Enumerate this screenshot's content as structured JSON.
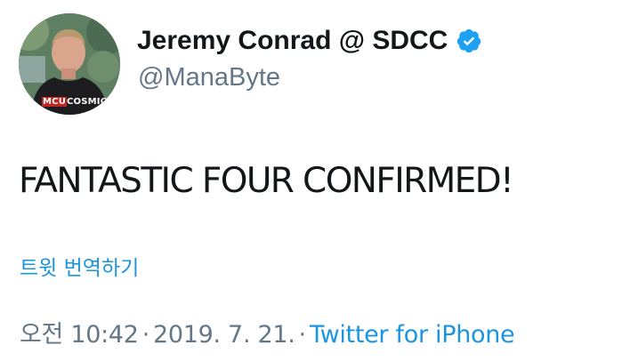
{
  "author": {
    "display_name": "Jeremy Conrad @ SDCC",
    "handle": "@ManaByte",
    "verified": true,
    "avatar_icon": "profile-photo",
    "shirt_text_part1": "MCU",
    "shirt_text_part2": "COSMIC"
  },
  "tweet": {
    "text": "FANTASTIC FOUR CONFIRMED!",
    "translate_label": "트윗 번역하기"
  },
  "meta": {
    "time": "오전 10:42",
    "separator": "·",
    "date": "2019. 7. 21.",
    "source": "Twitter for iPhone"
  },
  "colors": {
    "link": "#1b95e0",
    "secondary_text": "#657786",
    "primary_text": "#14171a",
    "verified_badge": "#1da1f2"
  }
}
